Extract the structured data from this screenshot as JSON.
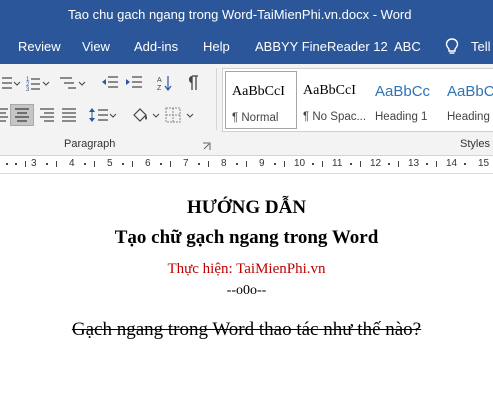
{
  "window": {
    "title": "Tao chu gach ngang trong Word-TaiMienPhi.vn.docx  -  Word"
  },
  "ribbon_tabs": [
    "Review",
    "View",
    "Add-ins",
    "Help",
    "ABBYY FineReader 12",
    "ABC",
    "Tell"
  ],
  "ribbon": {
    "paragraph_group_label": "Paragraph",
    "styles_group_label": "Styles",
    "styles": [
      {
        "sample": "AaBbCcI",
        "name": "¶ Normal"
      },
      {
        "sample": "AaBbCcI",
        "name": "¶ No Spac..."
      },
      {
        "sample": "AaBbCc",
        "name": "Heading 1"
      },
      {
        "sample": "AaBbCc",
        "name": "Heading"
      }
    ]
  },
  "ruler": {
    "numbers": [
      "3",
      "4",
      "5",
      "6",
      "7",
      "8",
      "9",
      "10",
      "11",
      "12",
      "13",
      "14",
      "15"
    ]
  },
  "document": {
    "heading1": "HƯỚNG DẪN",
    "heading2": "Tạo chữ gạch ngang trong Word",
    "credit": "Thực hiện: TaiMienPhi.vn",
    "separator": "--o0o--",
    "strikethrough_text": "Gạch ngang trong Word thao tác như thế nào?"
  },
  "colors": {
    "word_blue": "#2b579a",
    "heading_blue": "#2e74b5",
    "credit_red": "#c00000"
  }
}
